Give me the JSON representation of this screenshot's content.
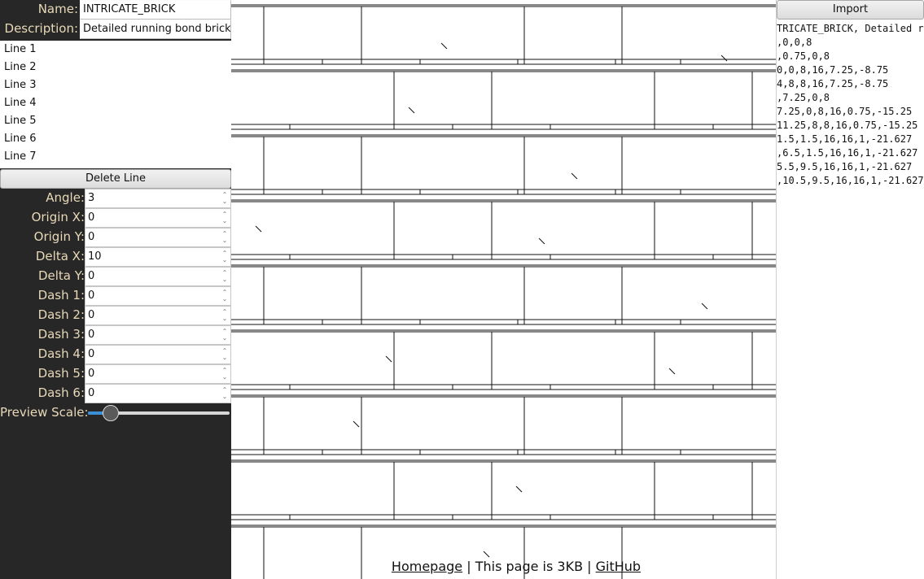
{
  "form": {
    "name_label": "Name:",
    "name_value": "INTRICATE_BRICK",
    "description_label": "Description:",
    "description_value": "Detailed running bond brick p"
  },
  "lines": [
    "Line 1",
    "Line 2",
    "Line 3",
    "Line 4",
    "Line 5",
    "Line 6",
    "Line 7"
  ],
  "delete_line_label": "Delete Line",
  "params": [
    {
      "label": "Angle:",
      "value": "3"
    },
    {
      "label": "Origin X:",
      "value": "0"
    },
    {
      "label": "Origin Y:",
      "value": "0"
    },
    {
      "label": "Delta X:",
      "value": "10"
    },
    {
      "label": "Delta Y:",
      "value": "0"
    },
    {
      "label": "Dash 1:",
      "value": "0"
    },
    {
      "label": "Dash 2:",
      "value": "0"
    },
    {
      "label": "Dash 3:",
      "value": "0"
    },
    {
      "label": "Dash 4:",
      "value": "0"
    },
    {
      "label": "Dash 5:",
      "value": "0"
    },
    {
      "label": "Dash 6:",
      "value": "0"
    }
  ],
  "preview_scale": {
    "label": "Preview Scale:",
    "value_fraction": 0.16
  },
  "import_label": "Import",
  "pat_lines": [
    "TRICATE_BRICK, Detailed r",
    ",0,0,8",
    ",0.75,0,8",
    "0,0,8,16,7.25,-8.75",
    "4,8,8,16,7.25,-8.75",
    ",7.25,0,8",
    "7.25,0,8,16,0.75,-15.25",
    "11.25,8,8,16,0.75,-15.25",
    "1.5,1.5,16,16,1,-21.627",
    ",6.5,1.5,16,16,1,-21.627",
    "5.5,9.5,16,16,1,-21.627",
    ",10.5,9.5,16,16,1,-21.627"
  ],
  "footer": {
    "homepage": "Homepage",
    "separator1": " | ",
    "size_text": "This page is 3KB",
    "separator2": " | ",
    "github": "GitHub"
  },
  "colors": {
    "panel_bg": "#272727",
    "label_text": "#e8d9b8",
    "slider_fill": "#3b8fd6"
  }
}
